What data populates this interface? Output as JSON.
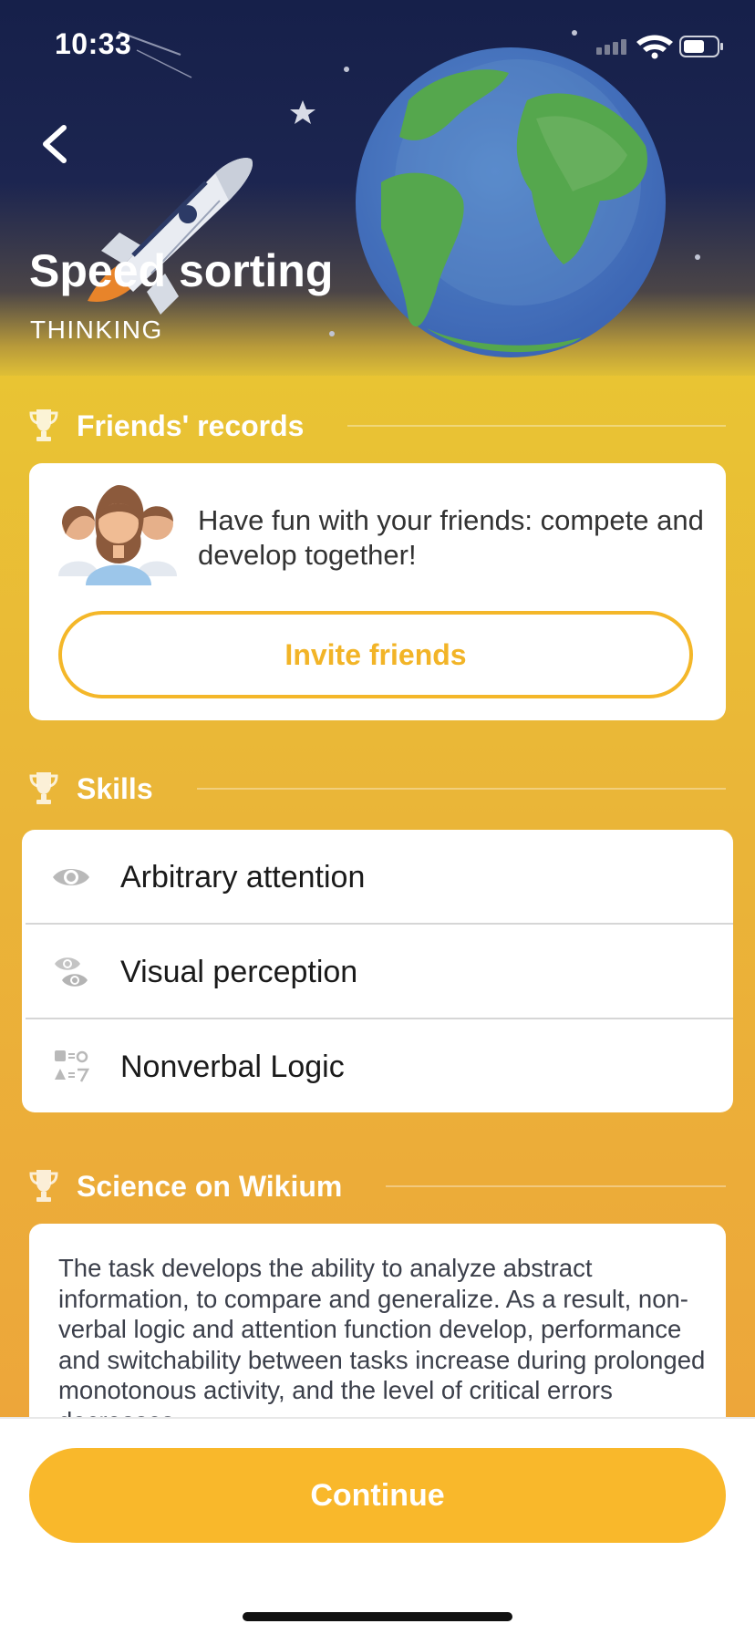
{
  "status_bar": {
    "time": "10:33"
  },
  "header": {
    "title": "Speed sorting",
    "category": "THINKING"
  },
  "friends_section": {
    "heading": "Friends' records",
    "message": "Have fun with your friends: compete and develop together!",
    "invite_label": "Invite friends"
  },
  "skills_section": {
    "heading": "Skills",
    "items": [
      {
        "label": "Arbitrary attention",
        "icon": "eye-icon"
      },
      {
        "label": "Visual perception",
        "icon": "double-eye-icon"
      },
      {
        "label": "Nonverbal Logic",
        "icon": "logic-symbols-icon"
      }
    ]
  },
  "science_section": {
    "heading": "Science on Wikium",
    "text": "The task develops the ability to analyze abstract information, to compare and generalize. As a result, non-verbal logic and attention function develop, performance and switchability between tasks increase during prolonged monotonous activity, and the level of critical errors decreases."
  },
  "footer": {
    "continue_label": "Continue"
  },
  "colors": {
    "accent": "#f9b82b",
    "background_top": "#e9c433",
    "background_bottom": "#eda63a",
    "hero_dark": "#16204a"
  }
}
